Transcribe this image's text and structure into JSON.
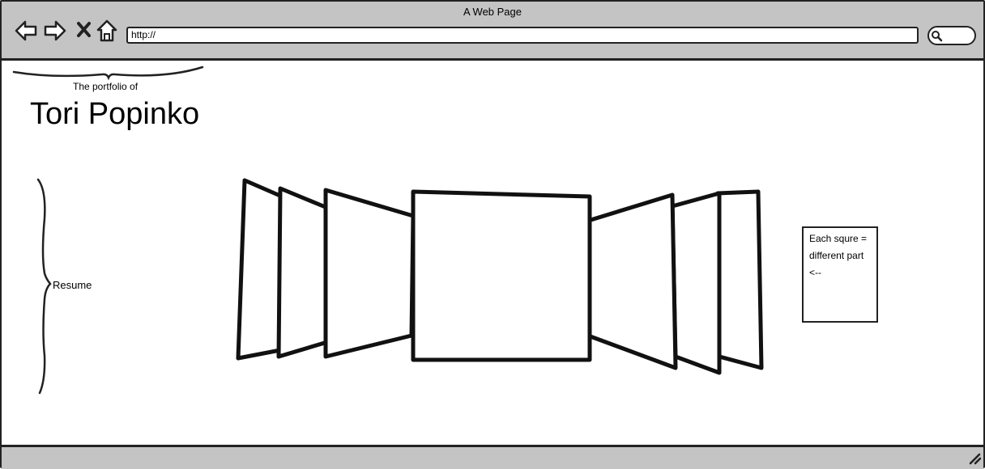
{
  "browser": {
    "window_title": "A Web Page",
    "address_value": "http://",
    "chrome_color": "#c4c4c4"
  },
  "page": {
    "subtitle": "The portfolio of",
    "name": "Tori Popinko",
    "side_label": "Resume",
    "note_lines": [
      "Each squre =",
      "different part",
      "<--"
    ]
  },
  "carousel": {
    "panel_count": 7
  },
  "icons": [
    "back-icon",
    "forward-icon",
    "stop-icon",
    "home-icon",
    "search-icon",
    "resize-grip-icon"
  ]
}
